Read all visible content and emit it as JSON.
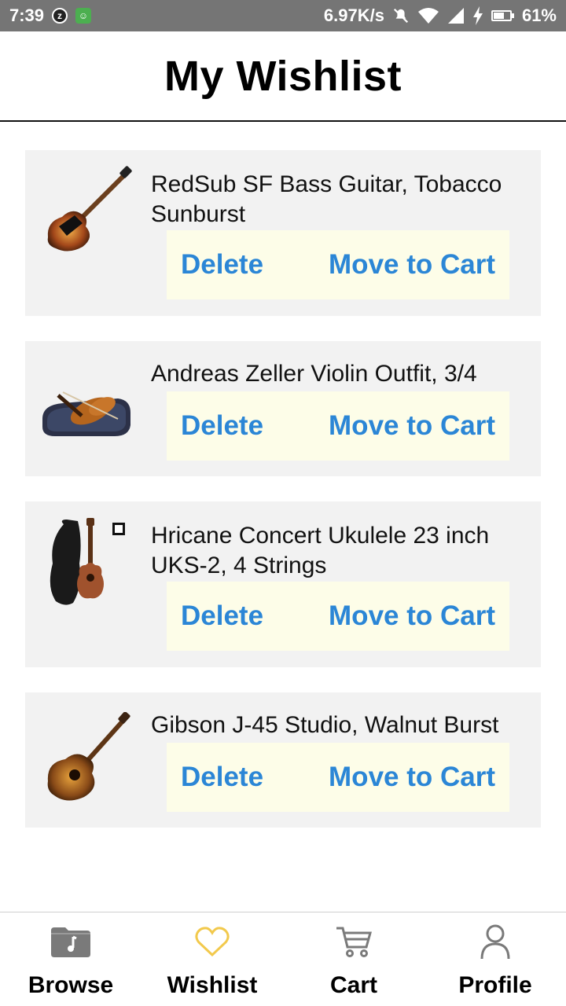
{
  "status_bar": {
    "time": "7:39",
    "network_speed": "6.97K/s",
    "battery": "61%"
  },
  "header": {
    "title": "My Wishlist"
  },
  "wishlist": {
    "items": [
      {
        "title": "RedSub SF Bass Guitar, Tobacco Sunburst",
        "delete_label": "Delete",
        "move_label": "Move to Cart",
        "image_icon": "bass-guitar-icon"
      },
      {
        "title": "Andreas Zeller Violin Outfit, 3/4",
        "delete_label": "Delete",
        "move_label": "Move to Cart",
        "image_icon": "violin-icon"
      },
      {
        "title": "Hricane Concert Ukulele 23 inch UKS-2, 4 Strings",
        "delete_label": "Delete",
        "move_label": "Move to Cart",
        "image_icon": "ukulele-icon"
      },
      {
        "title": "Gibson J-45 Studio, Walnut Burst",
        "delete_label": "Delete",
        "move_label": "Move to Cart",
        "image_icon": "acoustic-guitar-icon"
      }
    ]
  },
  "bottom_nav": {
    "items": [
      {
        "label": "Browse",
        "icon": "folder-music-icon"
      },
      {
        "label": "Wishlist",
        "icon": "heart-icon",
        "active": true
      },
      {
        "label": "Cart",
        "icon": "cart-icon"
      },
      {
        "label": "Profile",
        "icon": "person-icon"
      }
    ]
  },
  "colors": {
    "action_text": "#2b86d6",
    "action_bg": "#fdfde8",
    "card_bg": "#f2f2f2",
    "active_nav_icon": "#f2c94c",
    "inactive_nav_icon": "#7a7a7a"
  }
}
